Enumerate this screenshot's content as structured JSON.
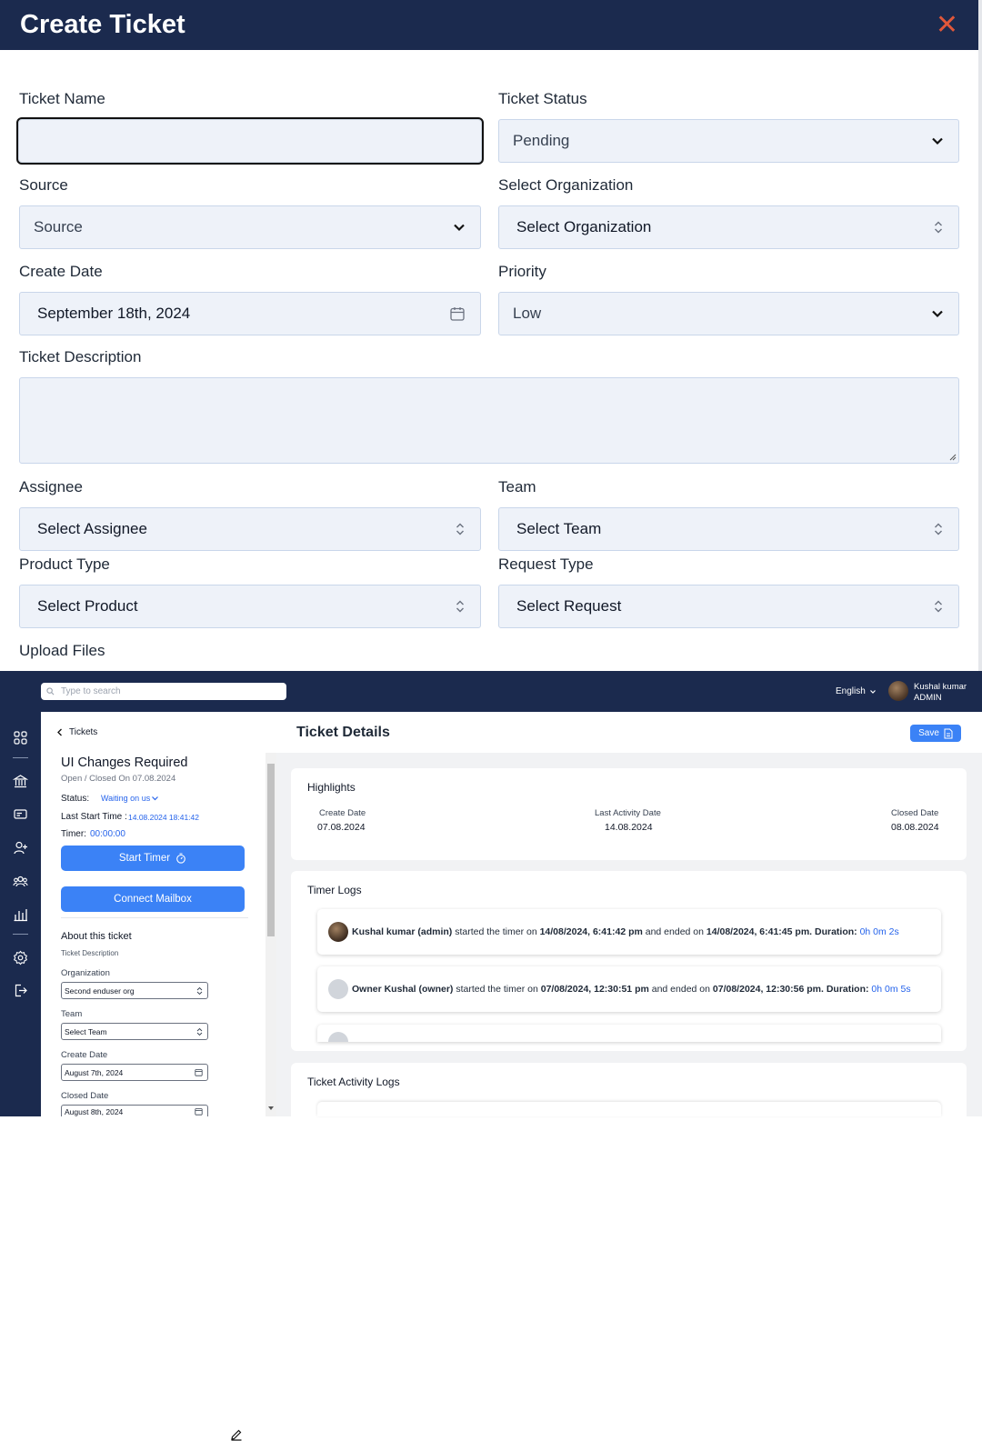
{
  "modal": {
    "title": "Create Ticket",
    "fields": {
      "ticket_name": {
        "label": "Ticket Name",
        "value": ""
      },
      "ticket_status": {
        "label": "Ticket Status",
        "value": "Pending"
      },
      "source": {
        "label": "Source",
        "value": "Source"
      },
      "organization": {
        "label": "Select Organization",
        "value": "Select Organization"
      },
      "create_date": {
        "label": "Create Date",
        "value": "September 18th, 2024"
      },
      "priority": {
        "label": "Priority",
        "value": "Low"
      },
      "description": {
        "label": "Ticket Description",
        "value": ""
      },
      "assignee": {
        "label": "Assignee",
        "value": "Select Assignee"
      },
      "team": {
        "label": "Team",
        "value": "Select Team"
      },
      "product_type": {
        "label": "Product Type",
        "value": "Select Product"
      },
      "request_type": {
        "label": "Request Type",
        "value": "Select Request"
      },
      "upload": {
        "label": "Upload Files"
      }
    }
  },
  "app": {
    "search_placeholder": "Type to search",
    "language": "English",
    "user": {
      "name": "Kushal kumar",
      "role": "ADMIN"
    },
    "back_label": "Tickets",
    "page_title": "Ticket Details",
    "save_label": "Save",
    "ticket": {
      "title": "UI Changes Required",
      "subtitle": "Open / Closed On 07.08.2024",
      "status_label": "Status:",
      "status_value": "Waiting on us",
      "last_start_label": "Last Start Time :",
      "last_start_value": "14.08.2024 18:41:42",
      "timer_label": "Timer:",
      "timer_value": "00:00:00",
      "start_timer": "Start Timer",
      "connect_mailbox": "Connect Mailbox",
      "about": "About this ticket",
      "description_label": "Ticket Description",
      "org_label": "Organization",
      "org_value": "Second enduser org",
      "team_label": "Team",
      "team_value": "Select Team",
      "create_label": "Create Date",
      "create_value": "August 7th, 2024",
      "closed_label": "Closed Date",
      "closed_value": "August 8th, 2024"
    },
    "highlights": {
      "title": "Highlights",
      "create_label": "Create Date",
      "create_value": "07.08.2024",
      "activity_label": "Last Activity Date",
      "activity_value": "14.08.2024",
      "closed_label": "Closed Date",
      "closed_value": "08.08.2024"
    },
    "timer_logs": {
      "title": "Timer Logs",
      "entries": [
        {
          "who": "Kushal kumar (admin)",
          "mid1": " started the timer on ",
          "start": "14/08/2024, 6:41:42 pm",
          "mid2": " and ended on ",
          "end": "14/08/2024, 6:41:45 pm.",
          "dur_label": " Duration: ",
          "dur": "0h 0m 2s"
        },
        {
          "who": "Owner Kushal (owner)",
          "mid1": " started the timer on ",
          "start": "07/08/2024, 12:30:51 pm",
          "mid2": " and ended on ",
          "end": "07/08/2024, 12:30:56 pm.",
          "dur_label": " Duration: ",
          "dur": "0h 0m 5s"
        }
      ]
    },
    "activity_logs": {
      "title": "Ticket Activity Logs"
    }
  },
  "colors": {
    "navy": "#1b2a4e",
    "accent": "#3b82f6",
    "close": "#e0573a",
    "field_bg": "#eef2f9"
  }
}
